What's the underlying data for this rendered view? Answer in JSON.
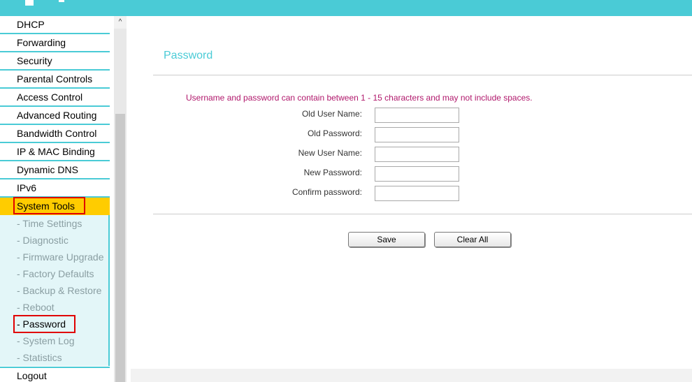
{
  "sidebar": {
    "items": [
      {
        "label": "DHCP"
      },
      {
        "label": "Forwarding"
      },
      {
        "label": "Security"
      },
      {
        "label": "Parental Controls"
      },
      {
        "label": "Access Control"
      },
      {
        "label": "Advanced Routing"
      },
      {
        "label": "Bandwidth Control"
      },
      {
        "label": "IP & MAC Binding"
      },
      {
        "label": "Dynamic DNS"
      },
      {
        "label": "IPv6"
      },
      {
        "label": "System Tools"
      }
    ],
    "sub_items": [
      {
        "label": "- Time Settings"
      },
      {
        "label": "- Diagnostic"
      },
      {
        "label": "- Firmware Upgrade"
      },
      {
        "label": "- Factory Defaults"
      },
      {
        "label": "- Backup & Restore"
      },
      {
        "label": "- Reboot"
      },
      {
        "label": "- Password"
      },
      {
        "label": "- System Log"
      },
      {
        "label": "- Statistics"
      }
    ],
    "logout": "Logout"
  },
  "scroll": {
    "up_arrow": "^"
  },
  "main": {
    "title": "Password",
    "note": "Username and password can contain between 1 - 15 characters and may not include spaces.",
    "fields": [
      {
        "label": "Old User Name:",
        "value": ""
      },
      {
        "label": "Old Password:",
        "value": ""
      },
      {
        "label": "New User Name:",
        "value": ""
      },
      {
        "label": "New Password:",
        "value": ""
      },
      {
        "label": "Confirm password:",
        "value": ""
      }
    ],
    "save_label": "Save",
    "clear_label": "Clear All"
  },
  "colors": {
    "accent": "#4acbd6",
    "active_menu": "#ffcc00",
    "note_text": "#b0176b",
    "highlight": "#e00000"
  }
}
